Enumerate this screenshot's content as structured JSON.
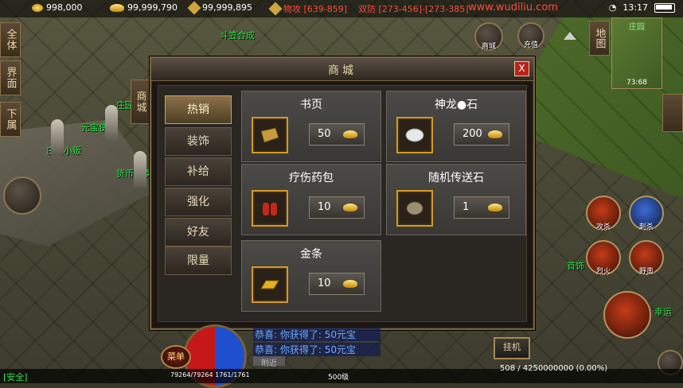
{
  "status": {
    "gold": "998,000",
    "ingot": "99,999,790",
    "bound_ingot": "99,999,895",
    "attack": "物攻 [639-859]",
    "defense": "双防 [273-456]-[273-385]",
    "site": "www.wudiliu.com",
    "time": "13:17"
  },
  "left_tabs": [
    "全体",
    "界面",
    "下属"
  ],
  "map_btn": "地图",
  "right_side_tab": "",
  "minimap": {
    "title": "庄园",
    "coords": "73:68"
  },
  "top_buttons": {
    "shop": "商城",
    "recharge": "充值"
  },
  "world_labels": {
    "quest": "斗笠合成",
    "npc1": "元宝使者",
    "npc2": "庄园小贩",
    "npc3": "货币兑换",
    "npc4": "庄园",
    "shop_sign": "商城"
  },
  "shop": {
    "title": "商城",
    "close": "X",
    "categories": [
      {
        "label": "热销",
        "active": true
      },
      {
        "label": "装饰",
        "active": false
      },
      {
        "label": "补给",
        "active": false
      },
      {
        "label": "强化",
        "active": false
      },
      {
        "label": "好友",
        "active": false
      },
      {
        "label": "限量",
        "active": false
      }
    ],
    "items": [
      {
        "name": "书页",
        "price": "50",
        "icon": "book-page-icon"
      },
      {
        "name": "神龙●石",
        "price": "200",
        "icon": "dragon-stone-icon"
      },
      {
        "name": "疗伤药包",
        "price": "10",
        "icon": "potion-pack-icon"
      },
      {
        "name": "随机传送石",
        "price": "1",
        "icon": "teleport-stone-icon"
      },
      {
        "name": "金条",
        "price": "10",
        "icon": "gold-bar-icon"
      }
    ]
  },
  "chat": {
    "lines": [
      "恭喜: 你获得了: 50元宝",
      "恭喜: 你获得了: 50元宝"
    ],
    "tab": "附近"
  },
  "hud": {
    "hp_mp": "79264/79264  1761/1761",
    "menu": "菜单",
    "hangup": "挂机",
    "level": "500级",
    "exp": "508 / 4250000000 (0.00%)",
    "safe": "[安全]"
  },
  "skills": {
    "s1": "攻杀",
    "s2": "刺杀",
    "s3": "烈火",
    "s4": "野蛮",
    "first": "首饰",
    "luck": "幸运"
  },
  "colors": {
    "accent_gold": "#d59a22",
    "safe_green": "#33e04a",
    "title_red": "#ff4a3a"
  }
}
